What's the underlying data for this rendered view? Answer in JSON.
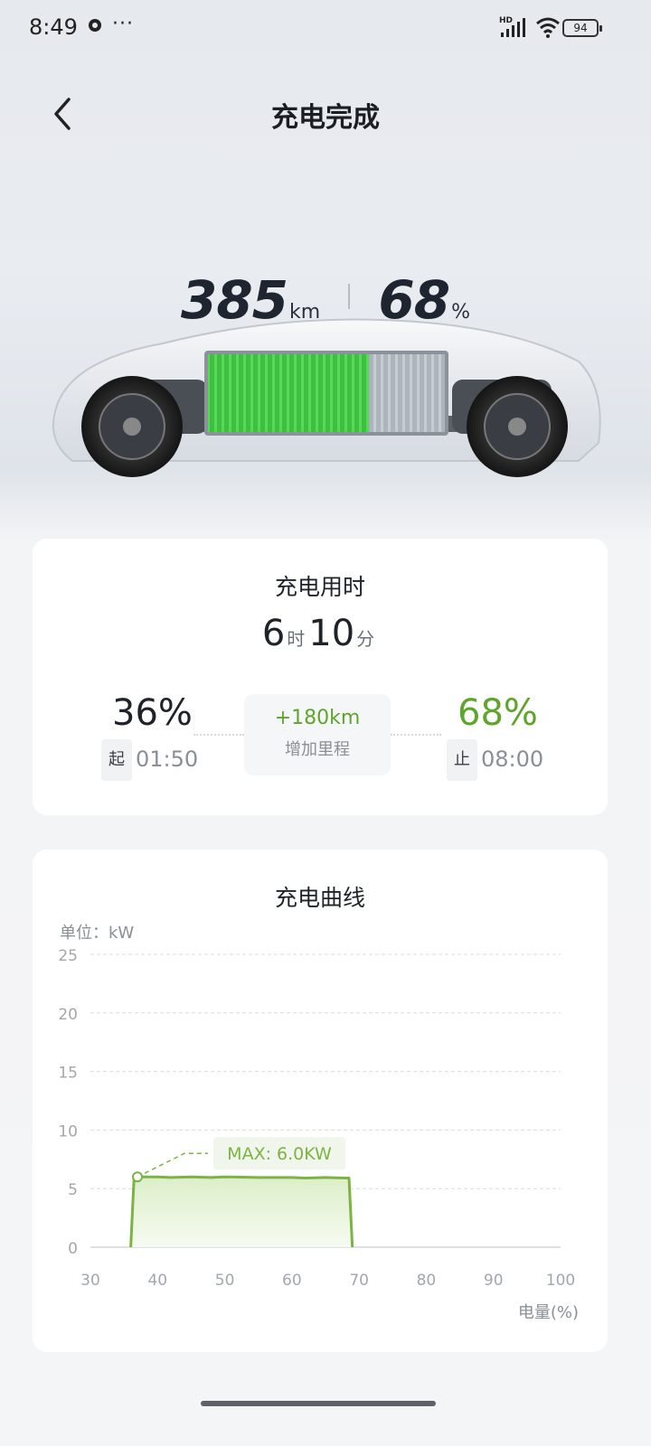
{
  "status_bar": {
    "time": "8:49",
    "more": "···",
    "network": "HD",
    "battery": "94",
    "icons": [
      "app-notification-icon",
      "signal-icon",
      "wifi-icon",
      "battery-icon"
    ]
  },
  "header": {
    "title": "充电完成",
    "back_icon": "chevron-left-icon"
  },
  "hero": {
    "range_value": "385",
    "range_unit": "km",
    "soc_value": "68",
    "soc_unit": "%",
    "battery_fill_fraction": 0.68
  },
  "charge_time": {
    "title": "充电用时",
    "hours": "6",
    "hours_unit": "时",
    "minutes": "10",
    "minutes_unit": "分",
    "start_soc": "36%",
    "start_tag": "起",
    "start_time": "01:50",
    "end_soc": "68%",
    "end_tag": "止",
    "end_time": "08:00",
    "gain_value": "+180km",
    "gain_label": "增加里程"
  },
  "curve": {
    "title": "充电曲线",
    "unit_label": "单位：kW",
    "axis_name": "电量(%)",
    "max_label": "MAX: 6.0KW"
  },
  "chart_data": {
    "type": "area",
    "title": "充电曲线",
    "xlabel": "电量(%)",
    "ylabel": "单位：kW",
    "xlim": [
      30,
      100
    ],
    "ylim": [
      0,
      25
    ],
    "x_ticks": [
      30,
      40,
      50,
      60,
      70,
      80,
      90,
      100
    ],
    "y_ticks": [
      0,
      5,
      10,
      15,
      20,
      25
    ],
    "grid": true,
    "series": [
      {
        "x": [
          36,
          36.5,
          37,
          40,
          42,
          45,
          48,
          50,
          55,
          60,
          62,
          65,
          68,
          68.5,
          69
        ],
        "y": [
          0,
          6.0,
          6.0,
          6.0,
          5.95,
          6.0,
          5.95,
          6.0,
          5.95,
          5.95,
          5.9,
          5.95,
          5.9,
          5.9,
          0
        ]
      }
    ],
    "max_point": {
      "x": 37,
      "y": 6.0
    },
    "annotation": "MAX: 6.0KW",
    "color": "#7cb342"
  }
}
